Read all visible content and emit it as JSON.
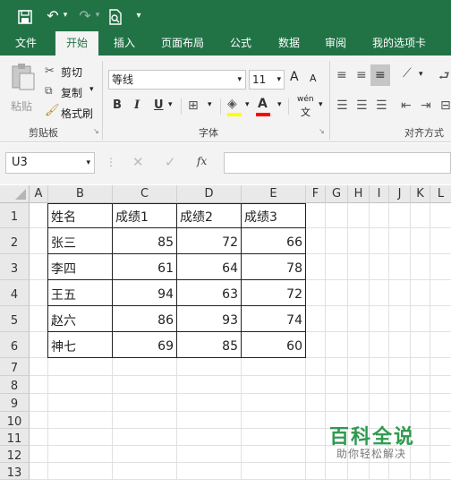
{
  "quick_access": {
    "save_icon": "save-icon",
    "undo_icon": "undo-icon",
    "redo_icon": "redo-icon",
    "print_preview_icon": "print-preview-icon"
  },
  "tabs": [
    "文件",
    "开始",
    "插入",
    "页面布局",
    "公式",
    "数据",
    "审阅",
    "我的选项卡"
  ],
  "active_tab": "开始",
  "clipboard": {
    "paste": "粘贴",
    "cut": "剪切",
    "copy": "复制",
    "format_painter": "格式刷",
    "group": "剪贴板"
  },
  "font": {
    "name": "等线",
    "size": "11",
    "bold": "B",
    "italic": "I",
    "underline": "U",
    "group": "字体",
    "grow": "A",
    "shrink": "A",
    "phonetic_top": "wén",
    "phonetic_bottom": "文",
    "fill_color": "#ffff00",
    "font_color": "#ff0000"
  },
  "alignment": {
    "group": "对齐方式"
  },
  "formula_bar": {
    "name_box": "U3",
    "fx": "fx",
    "formula": ""
  },
  "columns": [
    "A",
    "B",
    "C",
    "D",
    "E",
    "F",
    "G",
    "H",
    "I",
    "J",
    "K",
    "L"
  ],
  "rows": [
    "1",
    "2",
    "3",
    "4",
    "5",
    "6",
    "7",
    "8",
    "9",
    "10",
    "11",
    "12",
    "13"
  ],
  "table": {
    "headers": [
      "姓名",
      "成绩1",
      "成绩2",
      "成绩3"
    ],
    "rows": [
      [
        "张三",
        "85",
        "72",
        "66"
      ],
      [
        "李四",
        "61",
        "64",
        "78"
      ],
      [
        "王五",
        "94",
        "63",
        "72"
      ],
      [
        "赵六",
        "86",
        "93",
        "74"
      ],
      [
        "神七",
        "69",
        "85",
        "60"
      ]
    ]
  },
  "watermark": {
    "title": "百科全说",
    "subtitle": "助你轻松解决"
  }
}
